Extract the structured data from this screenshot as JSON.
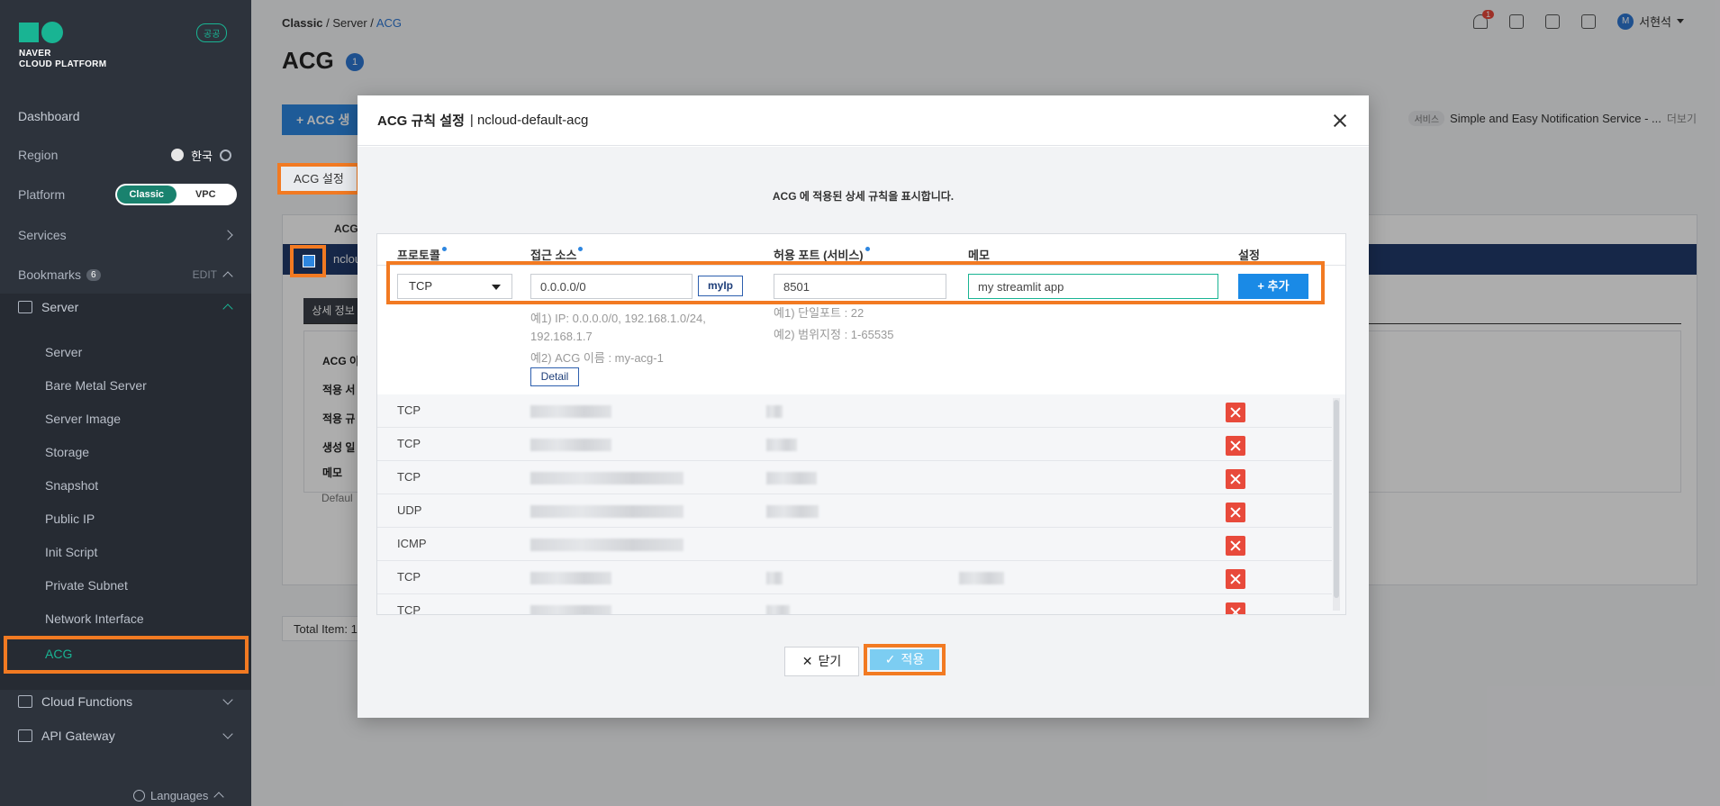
{
  "sidebar": {
    "brand": [
      "NAVER",
      "CLOUD PLATFORM"
    ],
    "gov_badge": "공공",
    "dashboard": "Dashboard",
    "region_label": "Region",
    "region_value": "한국",
    "platform_label": "Platform",
    "platform_on": "Classic",
    "platform_off": "VPC",
    "services": "Services",
    "bookmarks": "Bookmarks",
    "bookmarks_count": "6",
    "edit": "EDIT",
    "server_group": "Server",
    "server_items": [
      "Server",
      "Bare Metal Server",
      "Server Image",
      "Storage",
      "Snapshot",
      "Public IP",
      "Init Script",
      "Private Subnet",
      "Network Interface"
    ],
    "active_item": "ACG",
    "cloud_functions": "Cloud Functions",
    "api_gateway": "API Gateway",
    "languages": "Languages"
  },
  "header": {
    "breadcrumb": [
      "Classic",
      "Server",
      "ACG"
    ],
    "title": "ACG",
    "title_count": "1",
    "notif_count": "1",
    "user_initial": "M",
    "user_name": "서현석"
  },
  "page": {
    "create_button": "ACG 생",
    "notice_tag": "서비스",
    "notice_text": "Simple and Easy Notification Service - ...",
    "notice_more": "더보기",
    "acg_settings_button": "ACG 설정",
    "col_acg": "ACG",
    "row_name_partial": "ncloud",
    "detail_tab": "상세 정보",
    "detail_labels": [
      "ACG 이",
      "적용 서",
      "적용 규",
      "생성 일",
      "메모"
    ],
    "detail_default": "Defaul",
    "total_items": "Total Item: 1"
  },
  "modal": {
    "title_bold": "ACG 규칙 설정",
    "title_sub": "| ncloud-default-acg",
    "description": "ACG 에 적용된 상세 규칙을 표시합니다.",
    "columns": [
      "프로토콜",
      "접근 소스",
      "허용 포트 (서비스)",
      "메모",
      "설정"
    ],
    "form": {
      "protocol": "TCP",
      "source": "0.0.0.0/0",
      "myip_button": "myIp",
      "port": "8501",
      "memo": "my streamlit app",
      "add_button": "추가",
      "source_hint1": "예1) IP: 0.0.0.0/0, 192.168.1.0/24,",
      "source_hint1b": "192.168.1.7",
      "source_hint2": "예2) ACG 이름 : my-acg-1",
      "detail_button": "Detail",
      "port_hint1": "예1) 단일포트 : 22",
      "port_hint2": "예2) 범위지정 : 1-65535"
    },
    "rules": [
      {
        "protocol": "TCP"
      },
      {
        "protocol": "TCP"
      },
      {
        "protocol": "TCP"
      },
      {
        "protocol": "UDP"
      },
      {
        "protocol": "ICMP"
      },
      {
        "protocol": "TCP"
      },
      {
        "protocol": "TCP"
      }
    ],
    "close_button": "닫기",
    "apply_button": "적용"
  },
  "colors": {
    "accent_green": "#19b493",
    "highlight_orange": "#f27a22",
    "primary_blue": "#1a8ae6",
    "delete_red": "#e84a3b"
  }
}
